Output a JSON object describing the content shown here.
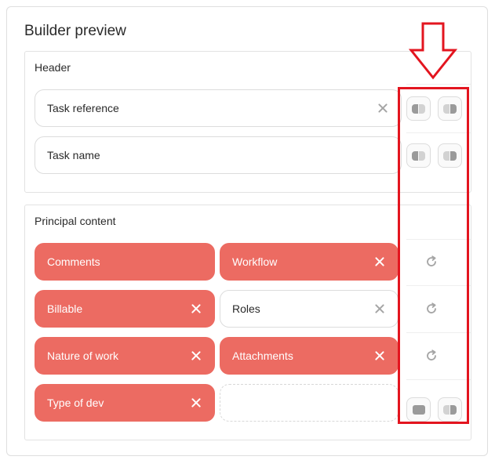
{
  "panel": {
    "title": "Builder preview"
  },
  "header_section": {
    "title": "Header",
    "fields": [
      {
        "label": "Task reference",
        "removable": true
      },
      {
        "label": "Task name",
        "removable": false
      }
    ]
  },
  "principal_section": {
    "title": "Principal content",
    "rows": [
      [
        {
          "label": "Comments",
          "active": true,
          "removable": false
        },
        {
          "label": "Workflow",
          "active": true,
          "removable": true
        }
      ],
      [
        {
          "label": "Billable",
          "active": true,
          "removable": true
        },
        {
          "label": "Roles",
          "active": false,
          "removable": true
        }
      ],
      [
        {
          "label": "Nature of work",
          "active": true,
          "removable": true
        },
        {
          "label": "Attachments",
          "active": true,
          "removable": true
        }
      ],
      [
        {
          "label": "Type of dev",
          "active": true,
          "removable": true
        },
        {
          "label": "",
          "active": false,
          "empty": true
        }
      ]
    ]
  },
  "colors": {
    "accent": "#ec6b62",
    "highlight": "#e3151f",
    "icon_gray": "#9a9a9a"
  },
  "icons": {
    "remove": "close-icon",
    "layout_left": "layout-left-half-icon",
    "layout_right": "layout-right-half-icon",
    "layout_full": "layout-full-width-icon",
    "reset": "refresh-icon",
    "annotation": "down-arrow-icon"
  }
}
